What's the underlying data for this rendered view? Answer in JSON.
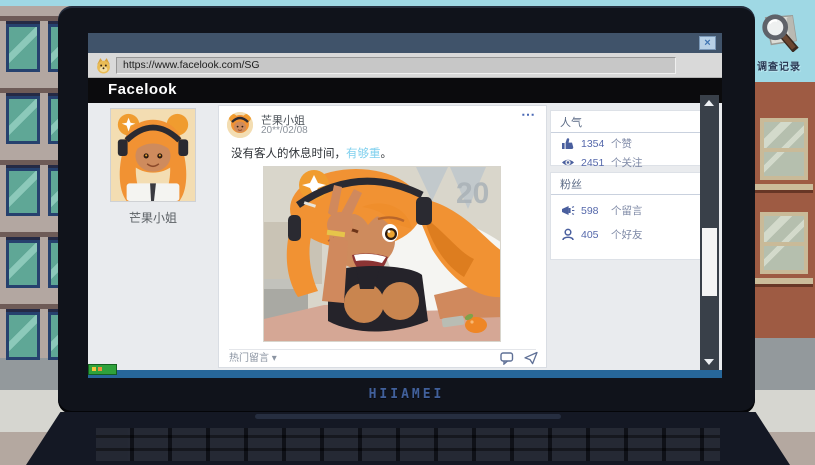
{
  "scene": {
    "investigate_button": "调查记录",
    "laptop_brand": "HIIAMEI"
  },
  "browser": {
    "url": "https://www.facelook.com/SG",
    "close_glyph": "×"
  },
  "facelook": {
    "logo": "Facelook",
    "profile": {
      "name": "芒果小姐"
    },
    "post": {
      "author": "芒果小姐",
      "date": "20**/02/08",
      "menu_glyph": "⋯",
      "text": "没有客人的休息时间，",
      "highlight": "有够重",
      "suffix": "。",
      "sort_label": "热门留言",
      "sort_caret": "▾"
    },
    "stats": {
      "popularity": {
        "title": "人气",
        "rows": [
          {
            "icon": "thumbs-up-icon",
            "value": "1354",
            "label": "个赞"
          },
          {
            "icon": "eye-icon",
            "value": "2451",
            "label": "个关注"
          }
        ]
      },
      "fans": {
        "title": "粉丝",
        "rows": [
          {
            "icon": "megaphone-icon",
            "value": "598",
            "label": "个留言"
          },
          {
            "icon": "person-icon",
            "value": "405",
            "label": "个好友"
          }
        ]
      }
    }
  },
  "colors": {
    "accent_blue": "#4a5f9e",
    "link_cyan": "#7fd0ee",
    "titlebar": "#40536a",
    "taskbar": "#27679a",
    "sky": "#9fd8e4"
  }
}
